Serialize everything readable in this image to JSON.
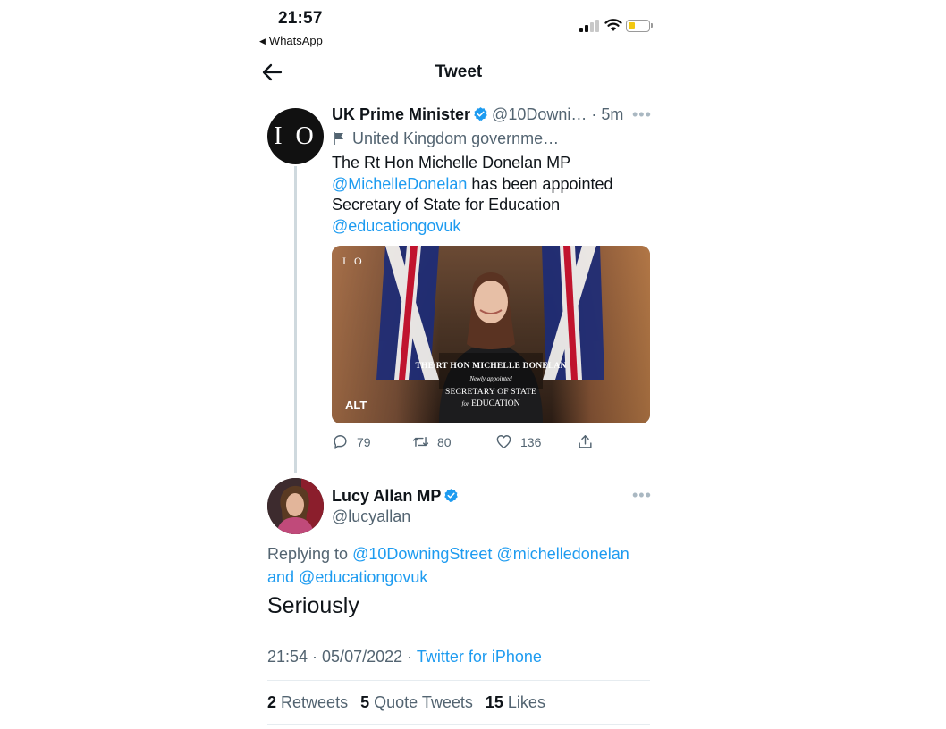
{
  "status_bar": {
    "time": "21:57",
    "back_app": "WhatsApp"
  },
  "nav": {
    "title": "Tweet"
  },
  "quoted_tweet": {
    "avatar_text": "I O",
    "name": "UK Prime Minister",
    "handle": "@10Downi…",
    "separator": " · ",
    "time": "5m",
    "label": "United Kingdom governme…",
    "text_line1": "The Rt Hon Michelle Donelan MP",
    "mention1": "@MichelleDonelan",
    "text_line2": " has been appointed",
    "text_line3": "Secretary of State for Education",
    "mention2": "@educationgovuk",
    "media": {
      "logo": "I O",
      "alt_badge": "ALT",
      "caption_line1": "THE RT HON MICHELLE DONELAN",
      "caption_line2": "Newly appointed",
      "caption_line3": "SECRETARY OF STATE",
      "caption_line4a": "for",
      "caption_line4b": "EDUCATION"
    },
    "actions": {
      "replies": "79",
      "retweets": "80",
      "likes": "136"
    }
  },
  "reply_tweet": {
    "name": "Lucy Allan MP",
    "handle": "@lucyallan",
    "replying_prefix": "Replying to ",
    "replying_to_1": "@10DowningStreet",
    "replying_to_2": "@michelledonelan",
    "replying_and": "and ",
    "replying_to_3": "@educationgovuk",
    "body": "Seriously",
    "timestamp": "21:54 · 05/07/2022 · ",
    "source": "Twitter for iPhone"
  },
  "stats": {
    "retweets_count": "2",
    "retweets_label": "Retweets",
    "quotes_count": "5",
    "quotes_label": "Quote Tweets",
    "likes_count": "15",
    "likes_label": "Likes"
  },
  "colors": {
    "link": "#1d9bf0",
    "muted": "#536471",
    "verified": "#1d9bf0",
    "battery": "#f2c811"
  }
}
